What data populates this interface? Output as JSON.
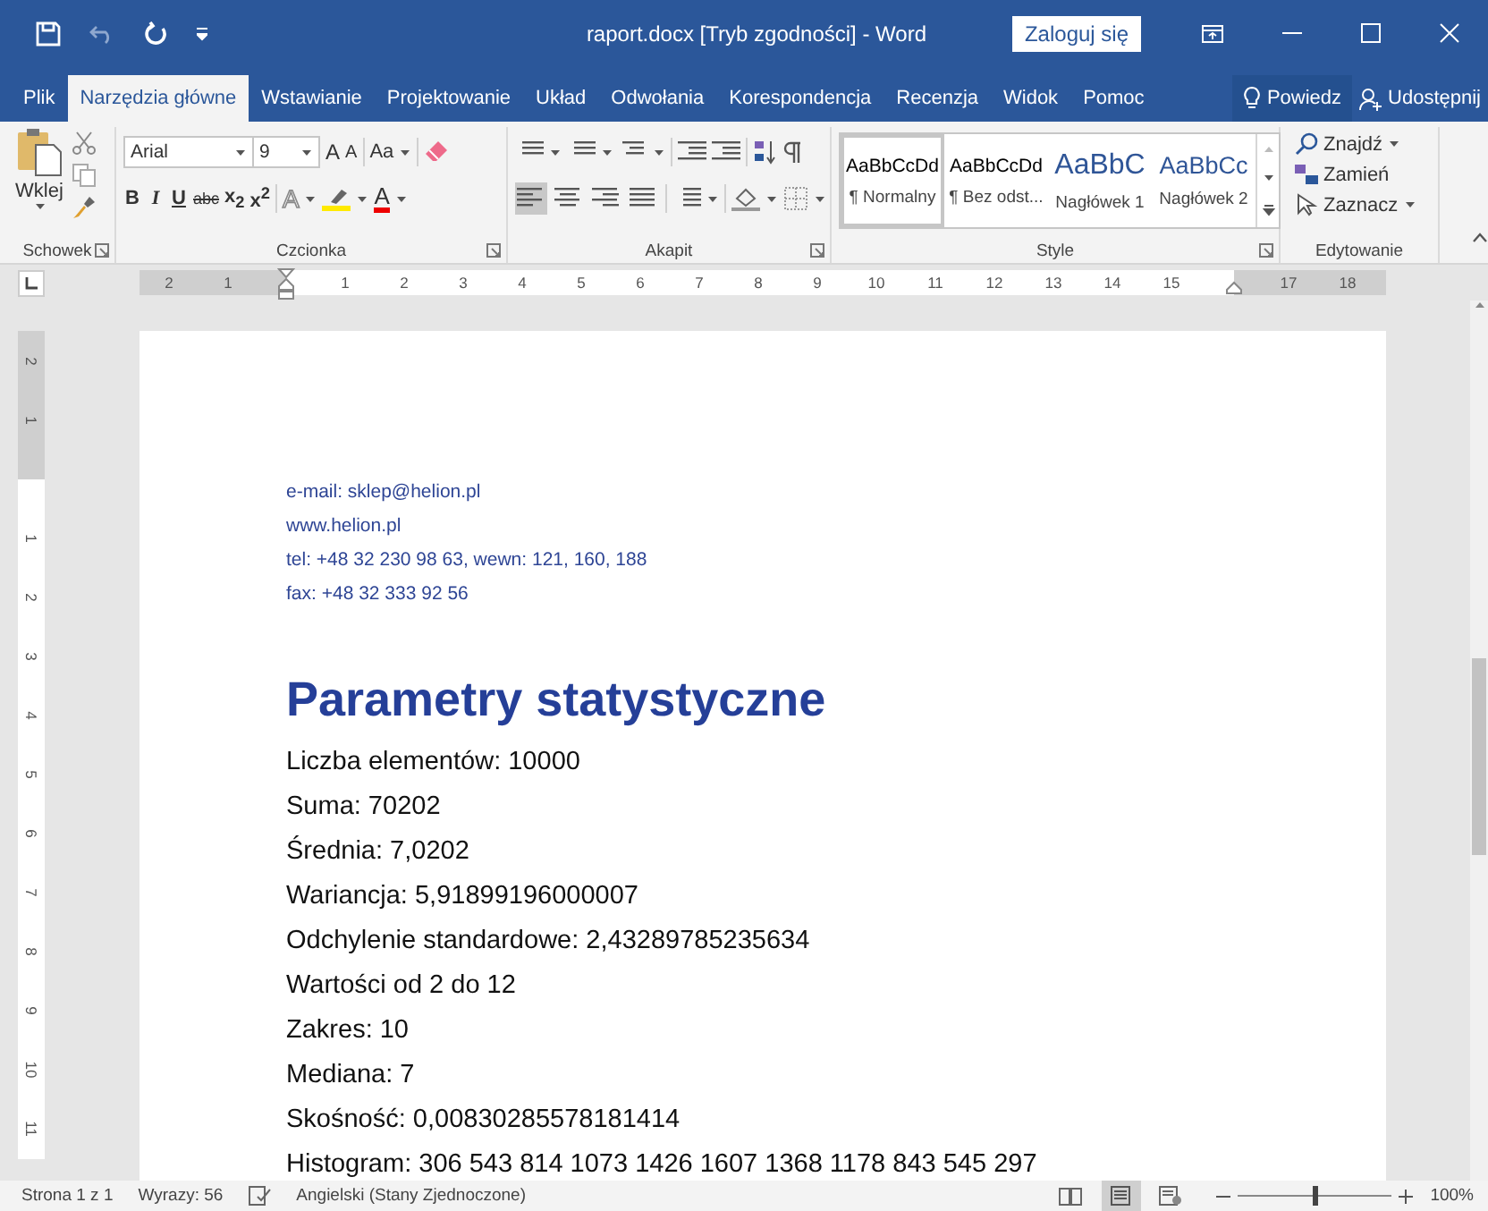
{
  "window": {
    "title": "raport.docx [Tryb zgodności]  -  Word",
    "sign_in": "Zaloguj się"
  },
  "tabs": [
    {
      "label": "Plik",
      "selected": false
    },
    {
      "label": "Narzędzia główne",
      "selected": true
    },
    {
      "label": "Wstawianie",
      "selected": false
    },
    {
      "label": "Projektowanie",
      "selected": false
    },
    {
      "label": "Układ",
      "selected": false
    },
    {
      "label": "Odwołania",
      "selected": false
    },
    {
      "label": "Korespondencja",
      "selected": false
    },
    {
      "label": "Recenzja",
      "selected": false
    },
    {
      "label": "Widok",
      "selected": false
    },
    {
      "label": "Pomoc",
      "selected": false
    }
  ],
  "tell_me": "Powiedz",
  "share": "Udostępnij",
  "ribbon": {
    "clipboard": {
      "paste": "Wklej",
      "label": "Schowek"
    },
    "font": {
      "name": "Arial",
      "size": "9",
      "grow": "A",
      "shrink": "A",
      "case_button": "Aa",
      "effects": "A",
      "color_button": "A",
      "label": "Czcionka",
      "format_buttons": [
        {
          "label": "B",
          "kind": "bold"
        },
        {
          "label": "I",
          "kind": "italic"
        },
        {
          "label": "U",
          "kind": "underline"
        },
        {
          "label": "abc",
          "kind": "strike"
        },
        {
          "label": "x$_{2}$",
          "kind": "plain"
        },
        {
          "label": "x$^{2}$",
          "kind": "plain"
        }
      ]
    },
    "paragraph": {
      "label": "Akapit",
      "alignments": [
        {
          "selected": true
        },
        {
          "selected": false
        },
        {
          "selected": false
        },
        {
          "selected": false
        }
      ]
    },
    "styles": {
      "label": "Style",
      "items": [
        {
          "preview": "AaBbCcDd",
          "name": "¶ Normalny",
          "kind": "normal",
          "selected": true
        },
        {
          "preview": "AaBbCcDd",
          "name": "¶ Bez odst...",
          "kind": "normal",
          "selected": false
        },
        {
          "preview": "AaBbC",
          "name": "Nagłówek 1",
          "kind": "heading1",
          "selected": false
        },
        {
          "preview": "AaBbCc",
          "name": "Nagłówek 2",
          "kind": "heading2",
          "selected": false
        }
      ]
    },
    "editing": {
      "label": "Edytowanie",
      "items": [
        {
          "label": "Znajdź",
          "kind": "find",
          "dropdown": true
        },
        {
          "label": "Zamień",
          "kind": "replace",
          "dropdown": false
        },
        {
          "label": "Zaznacz",
          "kind": "select",
          "dropdown": true
        }
      ]
    }
  },
  "ruler": {
    "left_margin_labels": [
      "2",
      "1"
    ],
    "labels": [
      "1",
      "2",
      "3",
      "4",
      "5",
      "6",
      "7",
      "8",
      "9",
      "10",
      "11",
      "12",
      "13",
      "14",
      "15"
    ],
    "right_margin_labels": [
      "17",
      "18"
    ]
  },
  "vertical_ruler": {
    "top_margin_labels": [
      "2",
      "1"
    ],
    "labels": [
      "1",
      "2",
      "3",
      "4",
      "5",
      "6",
      "7",
      "8",
      "9",
      "10",
      "11"
    ]
  },
  "document": {
    "contact": [
      "e-mail: sklep@helion.pl",
      "www.helion.pl",
      "tel: +48 32 230 98 63, wewn: 121, 160, 188",
      "fax: +48 32 333 92 56"
    ],
    "heading": "Parametry statystyczne",
    "lines": [
      "Liczba elementów: 10000",
      "Suma: 70202",
      "Średnia: 7,0202",
      "Wariancja: 5,91899196000007",
      "Odchylenie standardowe: 2,43289785235634",
      "Wartości od 2 do 12",
      "Zakres: 10",
      "Mediana: 7",
      "Skośność: 0,00830285578181414",
      "Histogram: 306 543 814 1073 1426 1607 1368 1178 843 545 297"
    ]
  },
  "status_bar": {
    "page": "Strona 1 z 1",
    "words": "Wyrazy: 56",
    "language": "Angielski (Stany Zjednoczone)",
    "views": [
      {
        "selected": false
      },
      {
        "selected": true
      },
      {
        "selected": false
      }
    ],
    "zoom": {
      "level": 0.5,
      "reading": "100%"
    }
  }
}
